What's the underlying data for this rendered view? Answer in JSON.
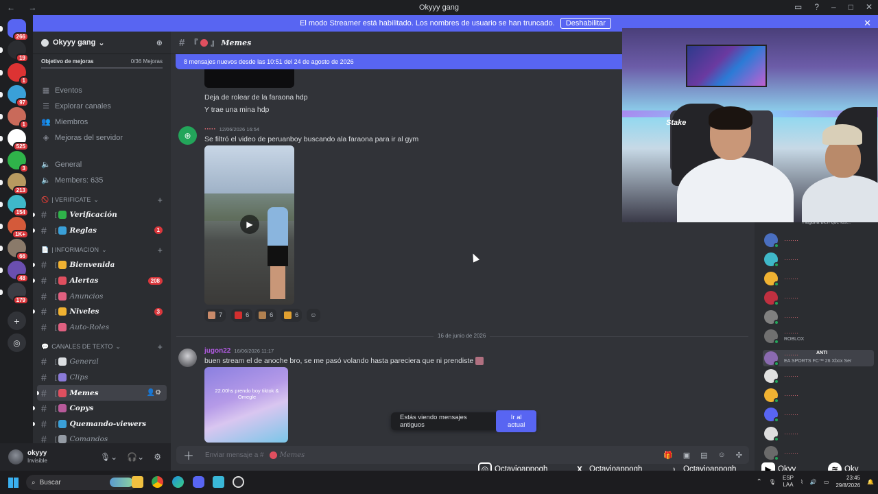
{
  "window": {
    "title": "Okyyy gang"
  },
  "banner": {
    "text": "El modo Streamer está habilitado. Los nombres de usuario se han truncado.",
    "button": "Deshabilitar"
  },
  "servers": [
    {
      "color": "#5865f2",
      "badge": "266"
    },
    {
      "color": "#2b2d31",
      "badge": "19"
    },
    {
      "color": "#d33",
      "badge": "1"
    },
    {
      "color": "#3aa0d8",
      "badge": "97"
    },
    {
      "color": "#c96a5a",
      "badge": "1"
    },
    {
      "color": "#ffffff",
      "badge": "525"
    },
    {
      "color": "#2fb34a",
      "badge": "3"
    },
    {
      "color": "#b89a60",
      "badge": "213"
    },
    {
      "color": "#3fb8c9",
      "badge": "154"
    },
    {
      "color": "#d45a3a",
      "badge": "1K+"
    },
    {
      "color": "#8a7a6a",
      "badge": "66"
    },
    {
      "color": "#6a4fb0",
      "badge": "48"
    },
    {
      "color": "#3b3d44",
      "badge": "179"
    }
  ],
  "sidebar": {
    "server_name": "Okyyy gang",
    "boost_label": "Objetivo de mejoras",
    "boost_count": "0/36 Mejoras",
    "nav": [
      {
        "label": "Eventos",
        "icon": "calendar-icon",
        "glyph": "▦"
      },
      {
        "label": "Explorar canales",
        "icon": "browse-icon",
        "glyph": "☰"
      },
      {
        "label": "Miembros",
        "icon": "members-icon",
        "glyph": "👥"
      },
      {
        "label": "Mejoras del servidor",
        "icon": "boost-icon",
        "glyph": "◈"
      }
    ],
    "voice": [
      {
        "label": "General",
        "icon": "speaker-icon"
      },
      {
        "label": "Members: 635",
        "icon": "speaker-icon"
      }
    ],
    "categories": [
      {
        "name": "| VERIFICATE",
        "channels": [
          {
            "name": "Verificación",
            "prefix": "[",
            "emoji": "#2fb34a",
            "unread": true
          },
          {
            "name": "Reglas",
            "prefix": "[",
            "emoji": "#3aa0d8",
            "unread": true,
            "count": "1"
          }
        ]
      },
      {
        "name": "| INFORMACION",
        "channels": [
          {
            "name": "Bienvenida",
            "prefix": "[",
            "emoji": "#f0b232",
            "unread": true
          },
          {
            "name": "Alertas",
            "prefix": "[",
            "emoji": "#e04f5f",
            "unread": true,
            "count": "208"
          },
          {
            "name": "Anuncios",
            "prefix": "[",
            "emoji": "#e06080",
            "unread": false
          },
          {
            "name": "Niveles",
            "prefix": "[",
            "emoji": "#f0b232",
            "unread": true,
            "count": "3"
          },
          {
            "name": "Auto-Roles",
            "prefix": "[",
            "emoji": "#e06080",
            "unread": false
          }
        ]
      },
      {
        "name": "CANALES DE TEXTO",
        "channels": [
          {
            "name": "General",
            "prefix": "[",
            "emoji": "#dbdee1",
            "unread": false
          },
          {
            "name": "Clips",
            "prefix": "[",
            "emoji": "#8a7ad8",
            "unread": false
          },
          {
            "name": "Memes",
            "prefix": "[",
            "emoji": "#e04f5f",
            "unread": true,
            "active": true
          },
          {
            "name": "Copys",
            "prefix": "[",
            "emoji": "#b85a9a",
            "unread": true
          },
          {
            "name": "Quemando-viewers",
            "prefix": "[",
            "emoji": "#3aa0d8",
            "unread": true
          },
          {
            "name": "Comandos",
            "prefix": "[",
            "emoji": "#949ba4",
            "unread": false
          }
        ]
      }
    ]
  },
  "user": {
    "name": "okyyy",
    "status": "Invisible"
  },
  "chat": {
    "channel": "Memes",
    "new_messages_bar": "8 mensajes nuevos desde las 10:51 del 24 de agosto de 2026",
    "lines_top": [
      "Deja de rolear de la faraona hdp",
      "Y trae una mina hdp"
    ],
    "msg1": {
      "author": "·····",
      "time": "12/06/2026 16:54",
      "text": "Se filtró el video de peruanboy buscando ala faraona para ir al gym"
    },
    "reactions": [
      {
        "count": "7",
        "color": "#c98a6a"
      },
      {
        "count": "6",
        "color": "#d32f2f"
      },
      {
        "count": "6",
        "color": "#b08050"
      },
      {
        "count": "6",
        "color": "#e0a030"
      }
    ],
    "date_divider": "16 de junio de 2026",
    "msg2": {
      "author": "jugon22",
      "time": "16/06/2026 11:17",
      "text": "buen stream el de anoche bro, se me pasó volando hasta pareciera que ni prendiste"
    },
    "image_text": "22.00hs prendo boy tiktok & Omegle",
    "old_notice": "Estás viendo mensajes antiguos",
    "jump_button": "Ir al actual",
    "composer_placeholder": "Enviar mensaje a #",
    "composer_channel": "Memes"
  },
  "members": [
    {
      "name": "·······",
      "color": "#e06c75",
      "avatar": "#4a6fc0",
      "activity": ""
    },
    {
      "name": "·······",
      "color": "#e06c75",
      "avatar": "#3fb8c9",
      "activity": ""
    },
    {
      "name": "·······",
      "color": "#e06c75",
      "avatar": "#f0b232",
      "activity": ""
    },
    {
      "name": "·······",
      "color": "#e06c75",
      "avatar": "#c03040",
      "activity": ""
    },
    {
      "name": "·······",
      "color": "#e06c75",
      "avatar": "#808080",
      "activity": ""
    },
    {
      "name": "·······",
      "color": "#e06c75",
      "avatar": "#707070",
      "activity": "ROBLOX"
    },
    {
      "name": "·······",
      "color": "#e06c75",
      "avatar": "#8a6ab0",
      "activity": "EA SPORTS FC™ 26 Xbox Ser"
    },
    {
      "name": "·······",
      "color": "#e06c75",
      "avatar": "#e0e0e0",
      "activity": ""
    },
    {
      "name": "·······",
      "color": "#e06c75",
      "avatar": "#f0b232",
      "activity": ""
    },
    {
      "name": "·······",
      "color": "#e06c75",
      "avatar": "#5865f2",
      "activity": ""
    },
    {
      "name": "·······",
      "color": "#e06c75",
      "avatar": "#dddddd",
      "activity": ""
    },
    {
      "name": "·······",
      "color": "#e06c75",
      "avatar": "#6a6a6a",
      "activity": ""
    }
  ],
  "member_top_activity": "Hagaria bien que los...",
  "member_tag": "ANTI",
  "webcam": {
    "brand": "Stake"
  },
  "socials": [
    {
      "handle": "Octavioappogh",
      "icon": "instagram-icon",
      "glyph": "◎"
    },
    {
      "handle": "Octavioappogh",
      "icon": "x-icon",
      "glyph": "X"
    },
    {
      "handle": "Octavioappogh",
      "icon": "tiktok-icon",
      "glyph": "♪"
    },
    {
      "handle": "Okyy",
      "icon": "youtube-icon",
      "glyph": "▶"
    },
    {
      "handle": "Oky",
      "icon": "spotify-icon",
      "glyph": "≋"
    }
  ],
  "taskbar": {
    "search_placeholder": "Buscar",
    "lang": "ESP",
    "lang2": "LAA",
    "time": "23:45",
    "date": "29/8/2026"
  }
}
